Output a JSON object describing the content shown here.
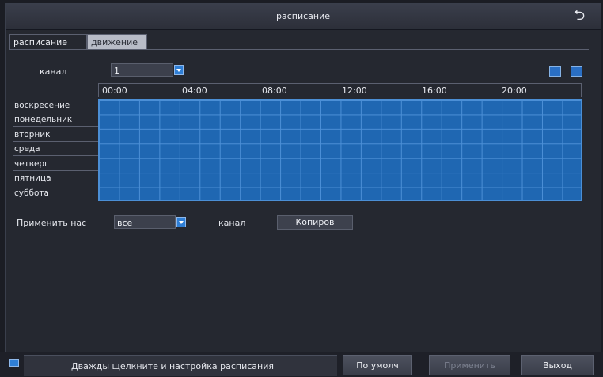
{
  "window": {
    "title": "расписание",
    "back_icon": "back-arrow-icon"
  },
  "tabs": [
    {
      "label": "расписание",
      "active": true
    },
    {
      "label": "движение",
      "active": false
    }
  ],
  "channel": {
    "label": "канал",
    "value": "1"
  },
  "toolbar_icons": [
    "edit-icon",
    "pencil-icon"
  ],
  "schedule": {
    "time_labels": [
      "00:00",
      "04:00",
      "08:00",
      "12:00",
      "16:00",
      "20:00"
    ],
    "days": [
      "воскресение",
      "понедельник",
      "вторник",
      "среда",
      "четверг",
      "пятница",
      "суббота"
    ],
    "fill_color": "#1f67b2"
  },
  "apply": {
    "label": "Применить нас",
    "value": "все",
    "channel_label": "канал",
    "copy_label": "Копиров"
  },
  "footer": {
    "hint_icon": "info-icon",
    "hint": "Дважды щелкните и настройка расписания",
    "default_label": "По умолч",
    "apply_label": "Применить",
    "exit_label": "Выход"
  }
}
